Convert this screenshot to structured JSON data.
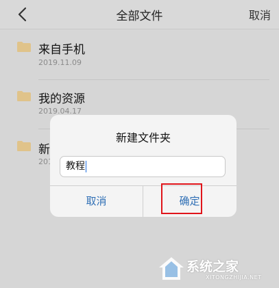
{
  "header": {
    "title": "全部文件",
    "cancel_label": "取消"
  },
  "folders": [
    {
      "name": "来自手机",
      "date": "2019.11.09"
    },
    {
      "name": "我的资源",
      "date": "2019.04.17"
    },
    {
      "name": "新",
      "date": "201"
    }
  ],
  "dialog": {
    "title": "新建文件夹",
    "input_value": "教程",
    "cancel_label": "取消",
    "confirm_label": "确定"
  },
  "watermark": {
    "text": "系统之家",
    "url": "XITONGZHIJIA.NET"
  },
  "colors": {
    "folder": "#e0c38a",
    "accent": "#2f6fb5",
    "highlight": "#e0141a"
  }
}
